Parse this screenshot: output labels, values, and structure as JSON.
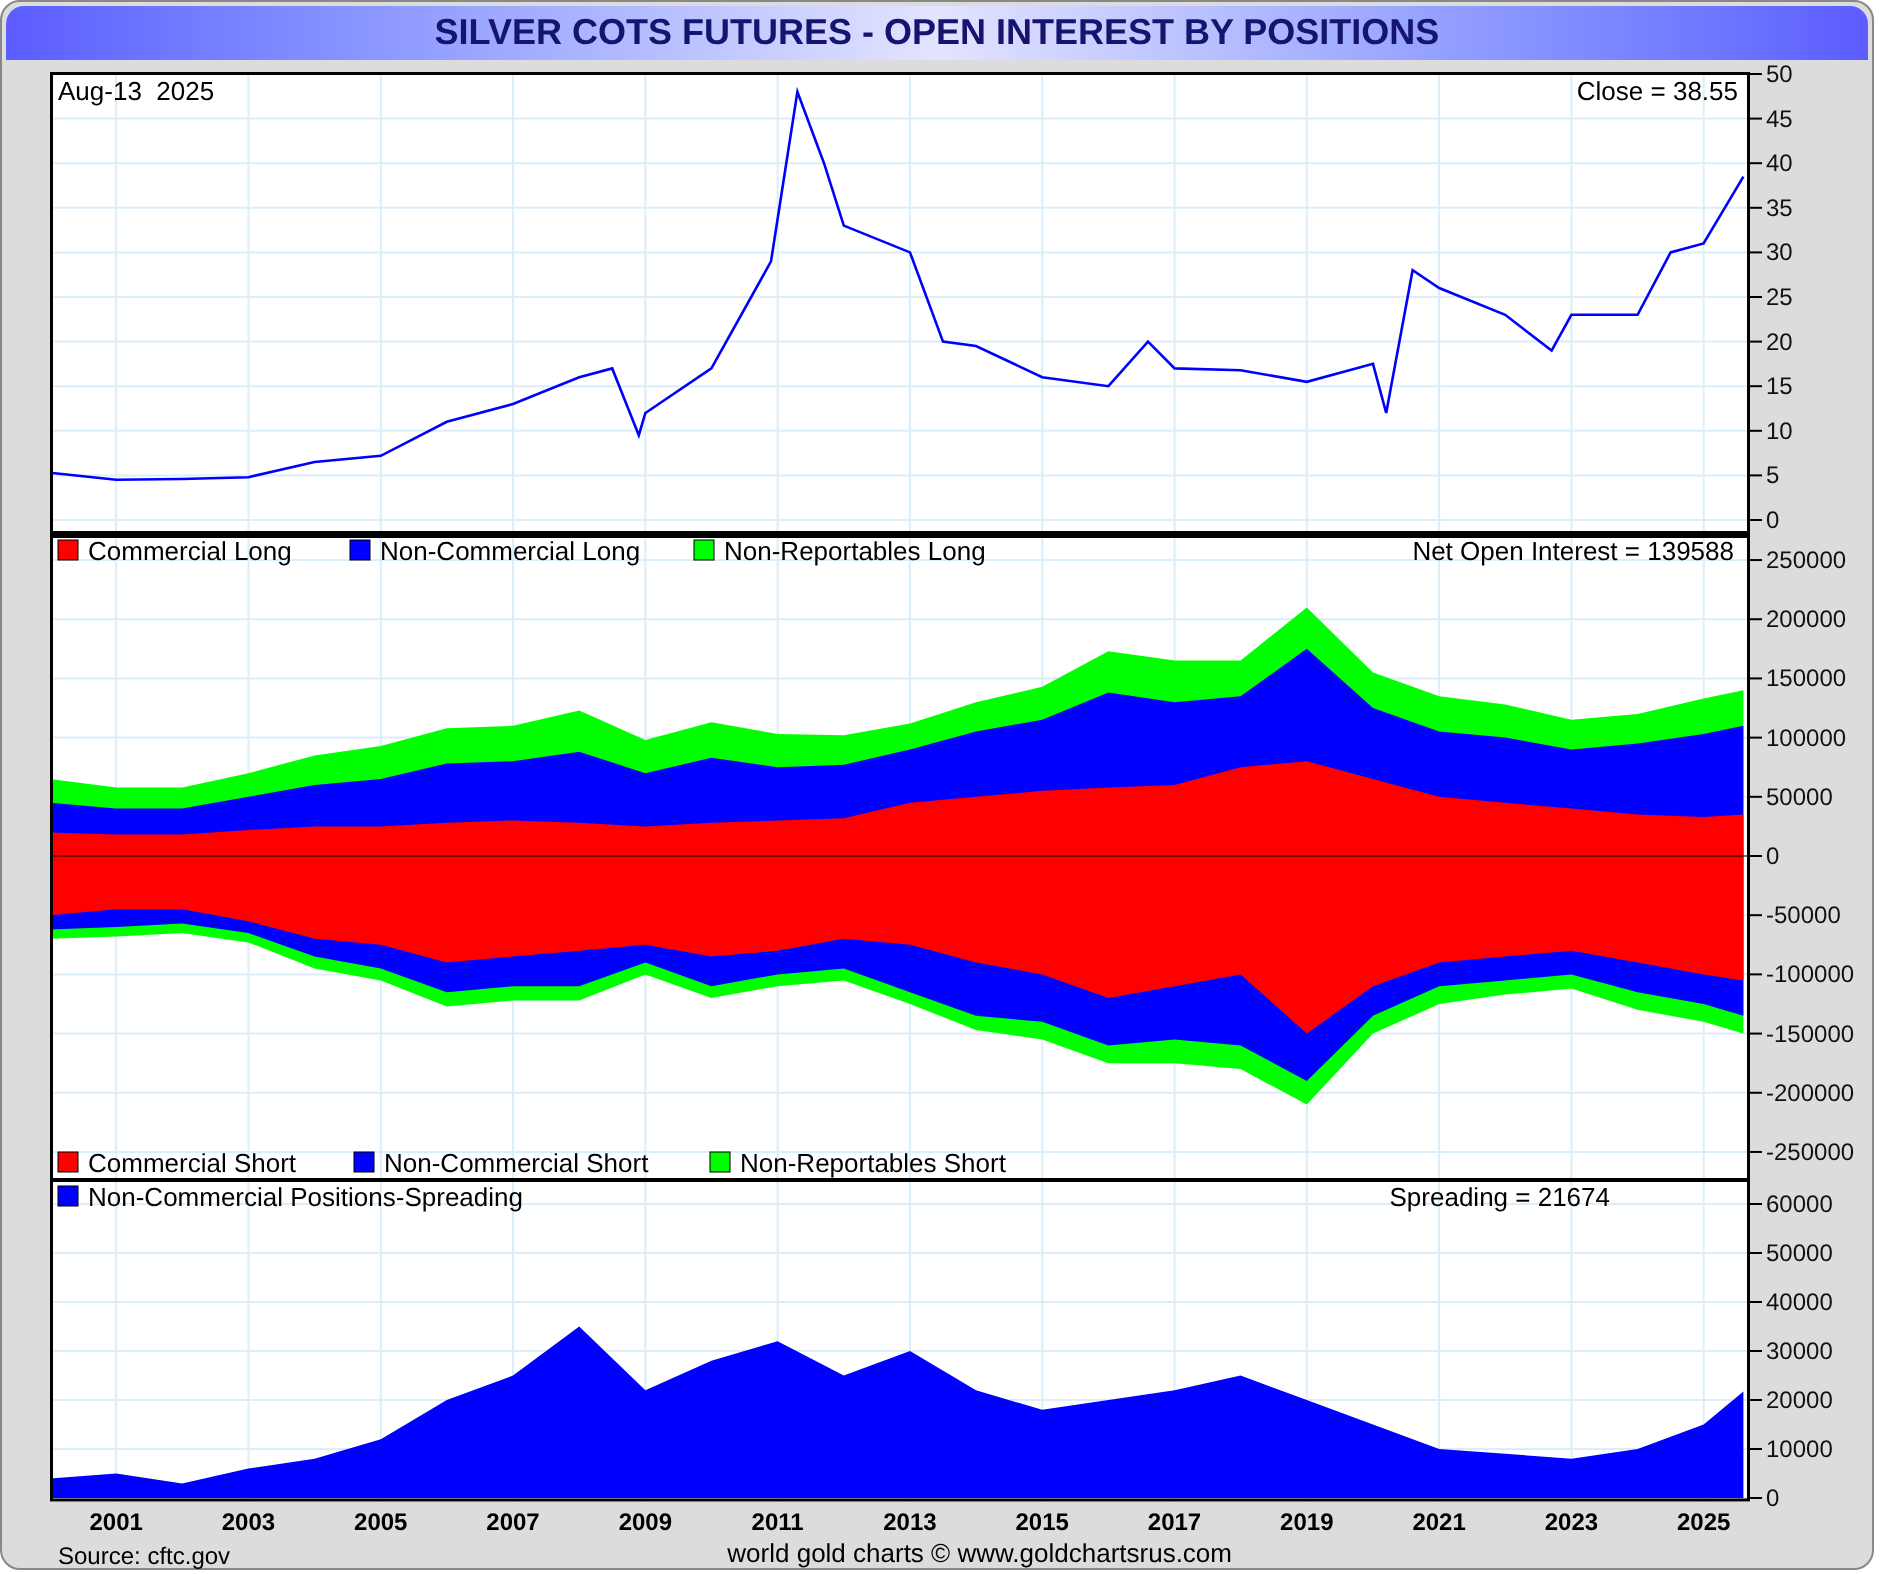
{
  "title": "SILVER COTS FUTURES - OPEN INTEREST BY POSITIONS",
  "price_panel": {
    "date": "Aug-13  2025",
    "close": "Close = 38.55",
    "chart_data": {
      "type": "line",
      "grid": true,
      "x": [
        2000,
        2001,
        2002,
        2003,
        2004,
        2005,
        2006,
        2007,
        2008,
        2008.5,
        2008.9,
        2009,
        2010,
        2010.9,
        2011.3,
        2011.7,
        2012,
        2013,
        2013.5,
        2014,
        2015,
        2016,
        2016.6,
        2017,
        2018,
        2019,
        2020,
        2020.2,
        2020.6,
        2021,
        2022,
        2022.7,
        2023,
        2024,
        2024.5,
        2025,
        2025.6
      ],
      "series": [
        {
          "color": "#0000ff",
          "values": [
            5.3,
            4.5,
            4.6,
            4.8,
            6.5,
            7.2,
            11,
            13,
            16,
            17,
            9.5,
            12,
            17,
            29,
            48,
            40,
            33,
            30,
            20,
            19.5,
            16,
            15,
            20,
            17,
            16.8,
            15.5,
            17.5,
            12,
            28,
            26,
            23,
            19,
            23,
            23,
            30,
            31,
            38.5
          ]
        }
      ],
      "xlim": [
        2000,
        2025.7
      ],
      "ylim": [
        0,
        50
      ],
      "yticks": [
        0,
        5,
        10,
        15,
        20,
        25,
        30,
        35,
        40,
        45,
        50
      ]
    }
  },
  "positions_panel": {
    "net": "Net Open Interest = 139588",
    "chart_data": {
      "type": "area",
      "stacked": false,
      "grid": true,
      "legend": true,
      "x": [
        2000,
        2001,
        2002,
        2003,
        2004,
        2005,
        2006,
        2007,
        2008,
        2009,
        2010,
        2011,
        2012,
        2013,
        2014,
        2015,
        2016,
        2017,
        2018,
        2019,
        2020,
        2021,
        2022,
        2023,
        2024,
        2025,
        2025.6
      ],
      "series": [
        {
          "name": "Commercial Long",
          "color": "#ff0000",
          "values": [
            20000,
            18000,
            18000,
            22000,
            25000,
            25000,
            28000,
            30000,
            28000,
            25000,
            28000,
            30000,
            32000,
            45000,
            50000,
            55000,
            58000,
            60000,
            75000,
            80000,
            65000,
            50000,
            45000,
            40000,
            35000,
            33000,
            35000
          ]
        },
        {
          "name": "Non-Commercial Long",
          "color": "#0000ff",
          "values": [
            45000,
            40000,
            40000,
            50000,
            60000,
            65000,
            78000,
            80000,
            88000,
            70000,
            83000,
            75000,
            77000,
            90000,
            105000,
            115000,
            138000,
            130000,
            135000,
            175000,
            125000,
            105000,
            100000,
            90000,
            95000,
            103000,
            110000
          ]
        },
        {
          "name": "Non-Reportables Long",
          "color": "#00ff00",
          "values": [
            65000,
            58000,
            58000,
            70000,
            85000,
            93000,
            108000,
            110000,
            123000,
            98000,
            113000,
            103000,
            102000,
            112000,
            130000,
            143000,
            173000,
            165000,
            165000,
            210000,
            155000,
            135000,
            128000,
            115000,
            120000,
            133000,
            140000
          ]
        },
        {
          "name": "Commercial Short",
          "color": "#ff0000",
          "values": [
            -50000,
            -45000,
            -45000,
            -55000,
            -70000,
            -75000,
            -90000,
            -85000,
            -80000,
            -75000,
            -85000,
            -80000,
            -70000,
            -75000,
            -90000,
            -100000,
            -120000,
            -110000,
            -100000,
            -150000,
            -110000,
            -90000,
            -85000,
            -80000,
            -90000,
            -100000,
            -105000
          ]
        },
        {
          "name": "Non-Commercial Short",
          "color": "#0000ff",
          "values": [
            -62000,
            -60000,
            -57000,
            -65000,
            -85000,
            -95000,
            -115000,
            -110000,
            -110000,
            -90000,
            -110000,
            -100000,
            -95000,
            -115000,
            -135000,
            -140000,
            -160000,
            -155000,
            -160000,
            -190000,
            -135000,
            -110000,
            -105000,
            -100000,
            -115000,
            -125000,
            -135000
          ]
        },
        {
          "name": "Non-Reportables Short",
          "color": "#00ff00",
          "values": [
            -70000,
            -68000,
            -65000,
            -73000,
            -95000,
            -105000,
            -127000,
            -122000,
            -122000,
            -100000,
            -120000,
            -110000,
            -105000,
            -125000,
            -147000,
            -155000,
            -175000,
            -175000,
            -180000,
            -210000,
            -150000,
            -125000,
            -117000,
            -112000,
            -130000,
            -140000,
            -150000
          ]
        }
      ],
      "xlim": [
        2000,
        2025.7
      ],
      "ylim": [
        -272000,
        272000
      ],
      "yticks": [
        -250000,
        -200000,
        -150000,
        -100000,
        -50000,
        0,
        50000,
        100000,
        150000,
        200000,
        250000
      ]
    }
  },
  "spreading_panel": {
    "reading": "Spreading = 21674",
    "chart_data": {
      "type": "area",
      "grid": true,
      "legend": true,
      "x": [
        2000,
        2001,
        2002,
        2003,
        2004,
        2005,
        2006,
        2007,
        2008,
        2009,
        2010,
        2011,
        2012,
        2013,
        2014,
        2015,
        2016,
        2017,
        2018,
        2019,
        2020,
        2021,
        2022,
        2023,
        2024,
        2025,
        2025.6
      ],
      "series": [
        {
          "name": "Non-Commercial Positions-Spreading",
          "color": "#0000ff",
          "values": [
            4000,
            5000,
            3000,
            6000,
            8000,
            12000,
            20000,
            25000,
            35000,
            22000,
            28000,
            32000,
            25000,
            30000,
            22000,
            18000,
            20000,
            22000,
            25000,
            20000,
            15000,
            10000,
            9000,
            8000,
            10000,
            15000,
            21700
          ]
        }
      ],
      "xlim": [
        2000,
        2025.7
      ],
      "ylim": [
        0,
        60000
      ],
      "yticks": [
        0,
        10000,
        20000,
        30000,
        40000,
        50000,
        60000
      ],
      "xticks": [
        2001,
        2003,
        2005,
        2007,
        2009,
        2011,
        2013,
        2015,
        2017,
        2019,
        2021,
        2023,
        2025
      ]
    }
  },
  "source": "Source: cftc.gov",
  "credit": "world gold charts © www.goldchartsrus.com"
}
